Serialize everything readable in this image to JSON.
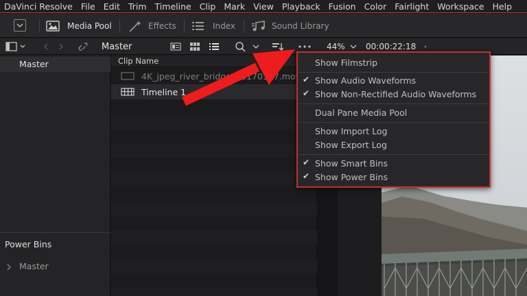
{
  "menubar": {
    "app": "DaVinci Resolve",
    "items": [
      "File",
      "Edit",
      "Trim",
      "Timeline",
      "Clip",
      "Mark",
      "View",
      "Playback",
      "Fusion",
      "Color",
      "Fairlight",
      "Workspace",
      "Help"
    ]
  },
  "toolbar": {
    "media_pool": "Media Pool",
    "effects": "Effects",
    "index": "Index",
    "sound_library": "Sound Library"
  },
  "bar2": {
    "bin_name": "Master",
    "zoom": "44%",
    "timecode": "00:00:22:18"
  },
  "left_panel": {
    "master": "Master",
    "power_bins": "Power Bins",
    "power_master": "Master"
  },
  "clip_list": {
    "header": "Clip Name",
    "rows": [
      {
        "name": "4K_jpeg_river_bridge_20170117.mov",
        "icon": "film-clip-icon"
      },
      {
        "name": "Timeline 1",
        "icon": "timeline-icon"
      }
    ]
  },
  "menu": {
    "items": [
      {
        "label": "Show Filmstrip",
        "checked": false
      },
      {
        "label": "Show Audio Waveforms",
        "checked": true
      },
      {
        "label": "Show Non-Rectified Audio Waveforms",
        "checked": true
      },
      {
        "label": "Dual Pane Media Pool",
        "checked": false
      },
      {
        "label": "Show Import Log",
        "checked": false
      },
      {
        "label": "Show Export Log",
        "checked": false
      },
      {
        "label": "Show Smart Bins",
        "checked": true
      },
      {
        "label": "Show Power Bins",
        "checked": true
      }
    ]
  },
  "colors": {
    "accent_red": "#c4302d",
    "arrow_red": "#ee1c1c"
  }
}
